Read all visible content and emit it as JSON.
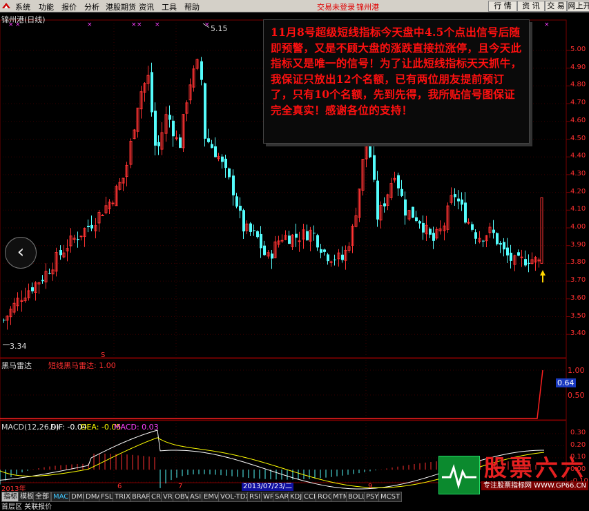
{
  "menubar": {
    "items": [
      "系统",
      "功能",
      "报价",
      "分析",
      "港股期货",
      "资讯",
      "工具",
      "帮助"
    ],
    "status": "交易未登录",
    "stock": "锦州港",
    "buttons": [
      "行 情",
      "资 讯",
      "交 易",
      "网上开"
    ]
  },
  "main_panel": {
    "title": "锦州港(日线)",
    "high_label": "5.15",
    "low_label": "3.34",
    "marker_s": "S",
    "y_ticks": [
      "5.00",
      "4.90",
      "4.80",
      "4.70",
      "4.60",
      "4.50",
      "4.40",
      "4.30",
      "4.20",
      "4.10",
      "4.00",
      "3.90",
      "3.80",
      "3.70",
      "3.60",
      "3.50",
      "3.40"
    ]
  },
  "popup_text": "11月8号超级短线指标今天盘中4.5个点出信号后随即预警，又是不顾大盘的涨跌直接拉涨停，且今天此指标又是唯一的信号！为了让此短线指标天天抓牛，我保证只放出12个名额，已有两位朋友提前预订了，只有10个名额，先到先得，我所贴信号图保证完全真实！感谢各位的支持！",
  "indicator_panel": {
    "name": "黑马雷达",
    "series_label": "短线黑马雷达: 1.00",
    "y_ticks": [
      "1.00",
      "0.50"
    ],
    "current_value": "0.64"
  },
  "macd_panel": {
    "name": "MACD(12,26,9)",
    "dif": "DIF: -0.04",
    "dea": "DEA: -0.05",
    "macd": "MACD: 0.03",
    "y_ticks": [
      "0.30",
      "0.20",
      "0.10",
      "0.00",
      "-0.10"
    ]
  },
  "x_axis": {
    "labels": [
      "2013年",
      "6",
      "7",
      "9"
    ],
    "cursor_date": "2013/07/23/二"
  },
  "tabs": [
    "指标",
    "模板",
    "全部",
    "MACD",
    "DMI",
    "DMA",
    "FSL",
    "TRIX",
    "BRAR",
    "CR",
    "VR",
    "OBV",
    "ASI",
    "EMV",
    "VOL-TDX",
    "RSI",
    "WR",
    "SAR",
    "KDJ",
    "CCI",
    "ROC",
    "MTM",
    "BOLL",
    "PSY",
    "MCST"
  ],
  "bottom_partial": "首层区  关联报价",
  "watermark": {
    "title": "股票六六",
    "sub": "专注股票指标网 WWW.GP66.CN"
  },
  "colors": {
    "up": "#ff3232",
    "down": "#54fcfc",
    "macd_dif": "#ffffff",
    "macd_dea": "#ffff00",
    "grid_red": "#8b0000"
  }
}
